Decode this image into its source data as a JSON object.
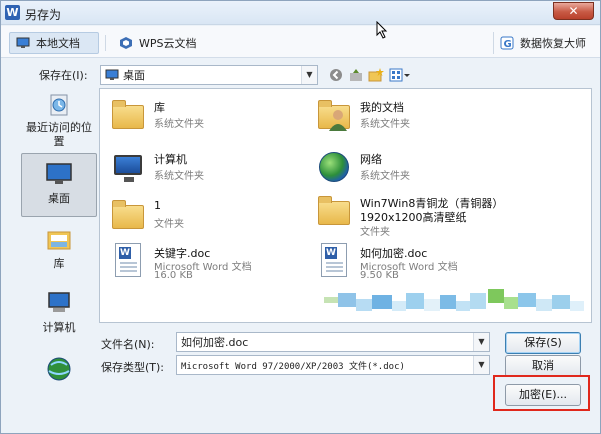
{
  "window": {
    "title": "另存为",
    "app_icon_letter": "W",
    "close_glyph": "✕"
  },
  "tabs": {
    "local": "本地文档",
    "wps_cloud": "WPS云文档",
    "recovery": "数据恢复大师"
  },
  "location": {
    "label": "保存在(I):",
    "value": "桌面"
  },
  "places": [
    {
      "label": "最近访问的位置"
    },
    {
      "label": "桌面"
    },
    {
      "label": "库"
    },
    {
      "label": "计算机"
    }
  ],
  "files": [
    {
      "name": "库",
      "type": "系统文件夹",
      "size": ""
    },
    {
      "name": "我的文档",
      "type": "系统文件夹",
      "size": ""
    },
    {
      "name": "计算机",
      "type": "系统文件夹",
      "size": ""
    },
    {
      "name": "网络",
      "type": "系统文件夹",
      "size": ""
    },
    {
      "name": "1",
      "type": "文件夹",
      "size": ""
    },
    {
      "name": "Win7Win8青铜龙（青铜器）",
      "line2": "1920x1200高清壁纸",
      "type": "文件夹",
      "size": ""
    },
    {
      "name": "关键字.doc",
      "type": "Microsoft Word 文档",
      "size": "16.0 KB"
    },
    {
      "name": "如何加密.doc",
      "type": "Microsoft Word 文档",
      "size": "9.50 KB"
    }
  ],
  "filename": {
    "label": "文件名(N):",
    "value": "如何加密.doc"
  },
  "filetype": {
    "label": "保存类型(T):",
    "value": "Microsoft Word 97/2000/XP/2003 文件(*.doc)"
  },
  "buttons": {
    "save": "保存(S)",
    "cancel": "取消",
    "encrypt": "加密(E)..."
  },
  "colors": {
    "highlight": "#e0281c",
    "accent": "#2f63b3"
  }
}
